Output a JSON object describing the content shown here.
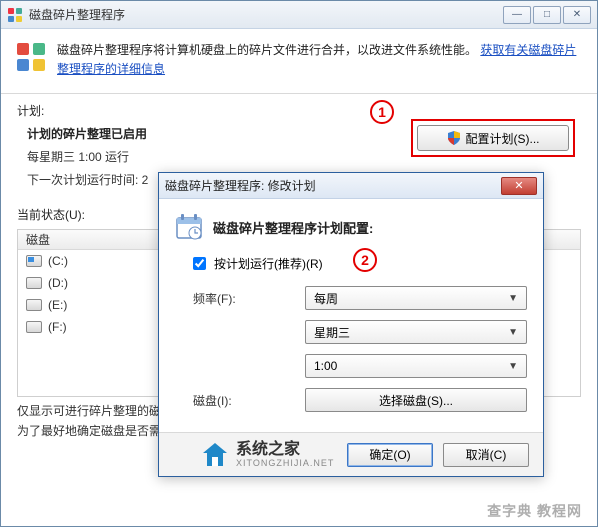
{
  "window": {
    "title": "磁盘碎片整理程序"
  },
  "header": {
    "text_before_link": "磁盘碎片整理程序将计算机硬盘上的碎片文件进行合并，以改进文件系统性能。",
    "link": "获取有关磁盘碎片整理程序的详细信息"
  },
  "schedule": {
    "section_label": "计划:",
    "enabled_title": "计划的碎片整理已启用",
    "run_line": "每星期三  1:00 运行",
    "next_run_prefix": "下一次计划运行时间: 2",
    "config_button": "配置计划(S)..."
  },
  "status": {
    "label": "当前状态(U):",
    "column_disk": "磁盘",
    "drives": [
      "(C:)",
      "(D:)",
      "(E:)",
      "(F:)"
    ]
  },
  "footer": {
    "line1": "仅显示可进行碎片整理的磁",
    "line2": "为了最好地确定磁盘是否需"
  },
  "modal": {
    "title": "磁盘碎片整理程序: 修改计划",
    "heading": "磁盘碎片整理程序计划配置:",
    "checkbox_label": "按计划运行(推荐)(R)",
    "checkbox_checked": true,
    "frequency_label": "频率(F):",
    "frequency_value": "每周",
    "day_value": "星期三",
    "time_value": "1:00",
    "disk_label": "磁盘(I):",
    "select_disk_button": "选择磁盘(S)...",
    "ok": "确定(O)",
    "cancel": "取消(C)"
  },
  "annotations": {
    "one": "1",
    "two": "2"
  },
  "watermark": {
    "brand": "系统之家",
    "domain": "XITONGZHIJIA.NET",
    "corner": "查字典  教程网"
  }
}
